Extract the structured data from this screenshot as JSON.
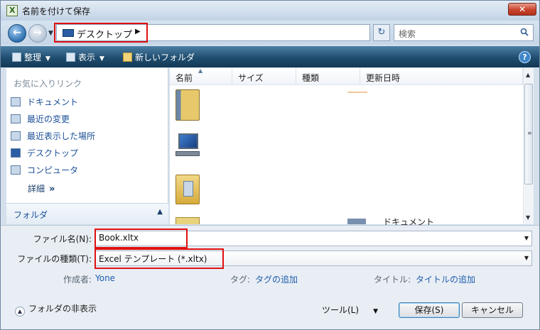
{
  "window": {
    "title": "名前を付けて保存",
    "close_label": "✕"
  },
  "address": {
    "location": "デスクトップ",
    "search_placeholder": "検索"
  },
  "toolbar": {
    "organize": "整理",
    "views": "表示",
    "new_folder": "新しいフォルダ"
  },
  "sidebar": {
    "favorites_header": "お気に入りリンク",
    "items": [
      {
        "label": "ドキュメント"
      },
      {
        "label": "最近の変更"
      },
      {
        "label": "最近表示した場所"
      },
      {
        "label": "デスクトップ"
      },
      {
        "label": "コンピュータ"
      }
    ],
    "details": "詳細",
    "folders": "フォルダ"
  },
  "file_list": {
    "columns": [
      "名前",
      "サイズ",
      "種類",
      "更新日時"
    ],
    "partial_item_label": "ドキュメント"
  },
  "form": {
    "filename_label": "ファイル名(N):",
    "filename_value": "Book.xltx",
    "filetype_label": "ファイルの種類(T):",
    "filetype_value": "Excel テンプレート (*.xltx)",
    "author_label": "作成者:",
    "author_value": "Yone",
    "tags_label": "タグ:",
    "tags_value": "タグの追加",
    "title_label": "タイトル:",
    "title_value": "タイトルの追加"
  },
  "footer": {
    "hide_folders": "フォルダの非表示",
    "tools": "ツール(L)",
    "save": "保存(S)",
    "cancel": "キャンセル"
  },
  "colors": {
    "highlight": "#e01010",
    "link": "#1f5cad",
    "toolbar": "#1f4d6f"
  }
}
